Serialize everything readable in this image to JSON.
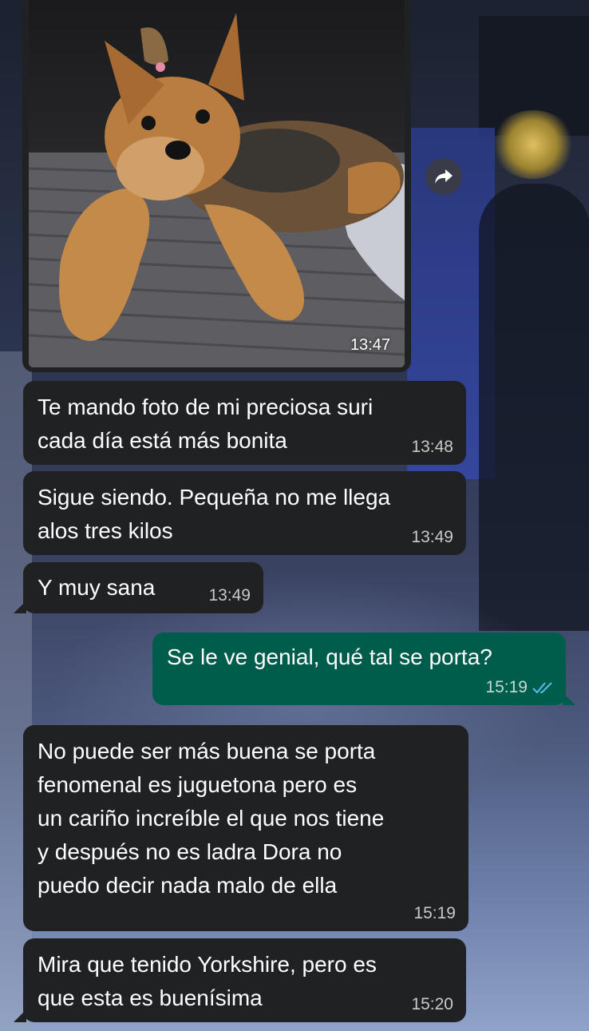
{
  "photo_message": {
    "time": "13:47"
  },
  "messages": [
    {
      "text": "Te mando foto de mi preciosa suri\ncada día está más bonita",
      "time": "13:48"
    },
    {
      "text": "Sigue siendo. Pequeña no me llega\nalos tres kilos",
      "time": "13:49"
    },
    {
      "text": "Y muy sana",
      "time": "13:49"
    },
    {
      "text": "Se le ve genial, qué tal se porta?",
      "time": "15:19"
    },
    {
      "text": "No puede ser más buena se porta\nfenomenal es juguetona pero es\nun cariño increíble el que nos tiene\ny después no es ladra Dora no\npuedo decir nada malo de ella",
      "time": "15:19"
    },
    {
      "text": "Mira que tenido Yorkshire, pero es\nque esta es buenísima",
      "time": "15:20"
    }
  ],
  "colors": {
    "incoming_bubble": "#202123",
    "outgoing_bubble": "#005c4b",
    "read_ticks": "#53bdeb"
  },
  "icons": {
    "forward": "forward-arrow-icon",
    "read_receipt": "double-check-icon"
  }
}
